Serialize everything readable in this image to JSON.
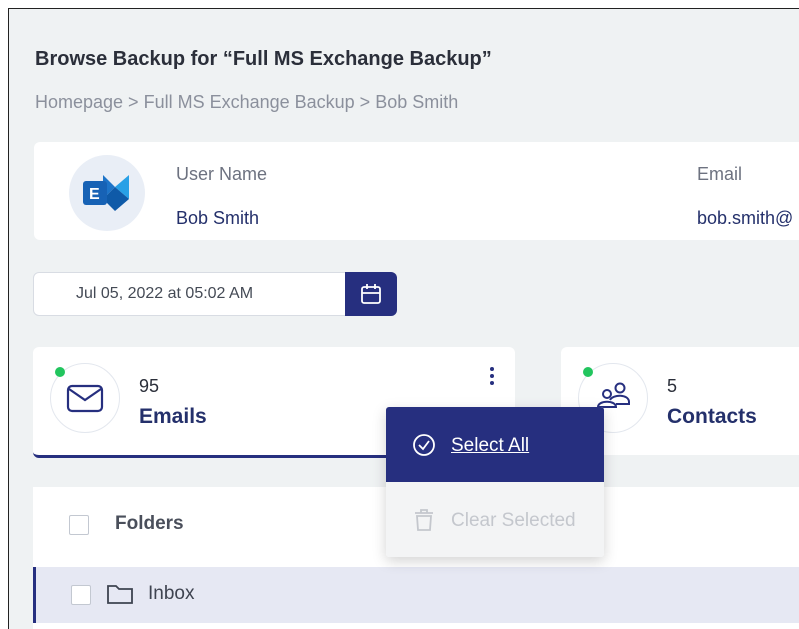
{
  "page": {
    "title": "Browse Backup for “Full MS Exchange Backup”",
    "breadcrumb": "Homepage > Full MS Exchange Backup > Bob Smith"
  },
  "user_card": {
    "avatar_icon": "outlook-exchange-icon",
    "user_name_label": "User Name",
    "user_name_value": "Bob Smith",
    "email_label": "Email",
    "email_value": "bob.smith@"
  },
  "date_picker": {
    "value": "Jul 05, 2022 at 05:02 AM",
    "button_icon": "calendar-icon"
  },
  "cards": {
    "emails": {
      "count": "95",
      "label": "Emails",
      "icon": "envelope-icon",
      "status_color": "#22c55e"
    },
    "contacts": {
      "count": "5",
      "label": "Contacts",
      "icon": "people-icon",
      "status_color": "#22c55e"
    }
  },
  "context_menu": {
    "select_all": "Select All",
    "clear_selected": "Clear Selected"
  },
  "folders": {
    "header": "Folders",
    "rows": [
      {
        "label": "Inbox",
        "icon": "folder-icon"
      }
    ]
  },
  "colors": {
    "accent": "#262f7f",
    "page_bg": "#eff2f3",
    "status_green": "#22c55e"
  }
}
